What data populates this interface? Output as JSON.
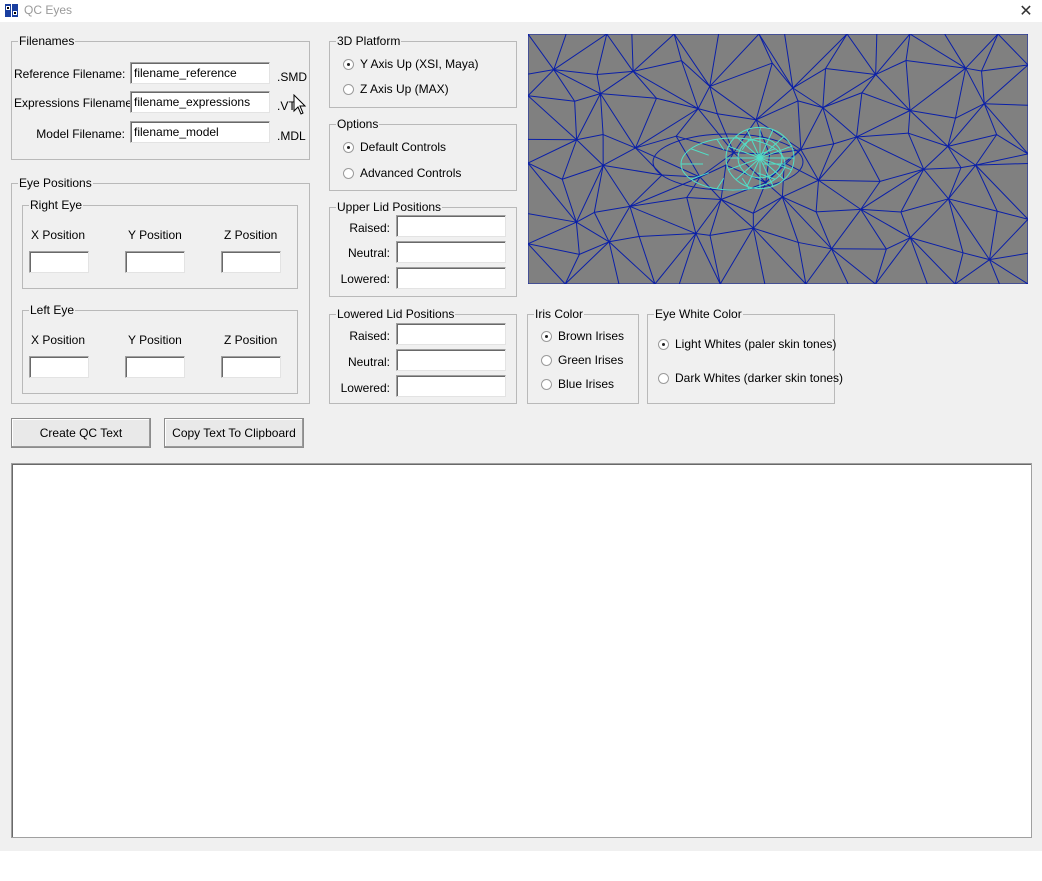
{
  "window": {
    "title": "QC Eyes",
    "close_glyph": "✕",
    "icon": "qc-eyes-app-icon"
  },
  "filenames": {
    "legend": "Filenames",
    "reference": {
      "label": "Reference Filename:",
      "value": "filename_reference",
      "ext": ".SMD"
    },
    "expressions": {
      "label": "Expressions Filename:",
      "value": "filename_expressions",
      "ext": ".VT"
    },
    "model": {
      "label": "Model Filename:",
      "value": "filename_model",
      "ext": ".MDL"
    }
  },
  "eye_positions": {
    "legend": "Eye Positions",
    "right_eye": {
      "legend": "Right Eye",
      "x_label": "X Position",
      "y_label": "Y Position",
      "z_label": "Z Position",
      "x": "",
      "y": "",
      "z": ""
    },
    "left_eye": {
      "legend": "Left Eye",
      "x_label": "X Position",
      "y_label": "Y Position",
      "z_label": "Z Position",
      "x": "",
      "y": "",
      "z": ""
    }
  },
  "platform": {
    "legend": "3D Platform",
    "options": [
      "Y Axis Up (XSI, Maya)",
      "Z Axis Up (MAX)"
    ],
    "selected": 0
  },
  "options": {
    "legend": "Options",
    "items": [
      "Default Controls",
      "Advanced Controls"
    ],
    "selected": 0
  },
  "upper_lid": {
    "legend": "Upper Lid Positions",
    "raised_label": "Raised:",
    "neutral_label": "Neutral:",
    "lowered_label": "Lowered:",
    "raised": "",
    "neutral": "",
    "lowered": ""
  },
  "lower_lid": {
    "legend": "Lowered Lid Positions",
    "raised_label": "Raised:",
    "neutral_label": "Neutral:",
    "lowered_label": "Lowered:",
    "raised": "",
    "neutral": "",
    "lowered": ""
  },
  "iris_color": {
    "legend": "Iris Color",
    "options": [
      "Brown Irises",
      "Green Irises",
      "Blue Irises"
    ],
    "selected": 0
  },
  "eye_white": {
    "legend": "Eye White Color",
    "options": [
      "Light Whites (paler skin tones)",
      "Dark Whites (darker skin tones)"
    ],
    "selected": 0
  },
  "buttons": {
    "create": "Create QC Text",
    "copy": "Copy Text To Clipboard"
  },
  "output": {
    "text": ""
  },
  "preview": {
    "background": "#808080",
    "mesh_color": "#0a1fa8",
    "eye_color": "#4fe0c8"
  }
}
